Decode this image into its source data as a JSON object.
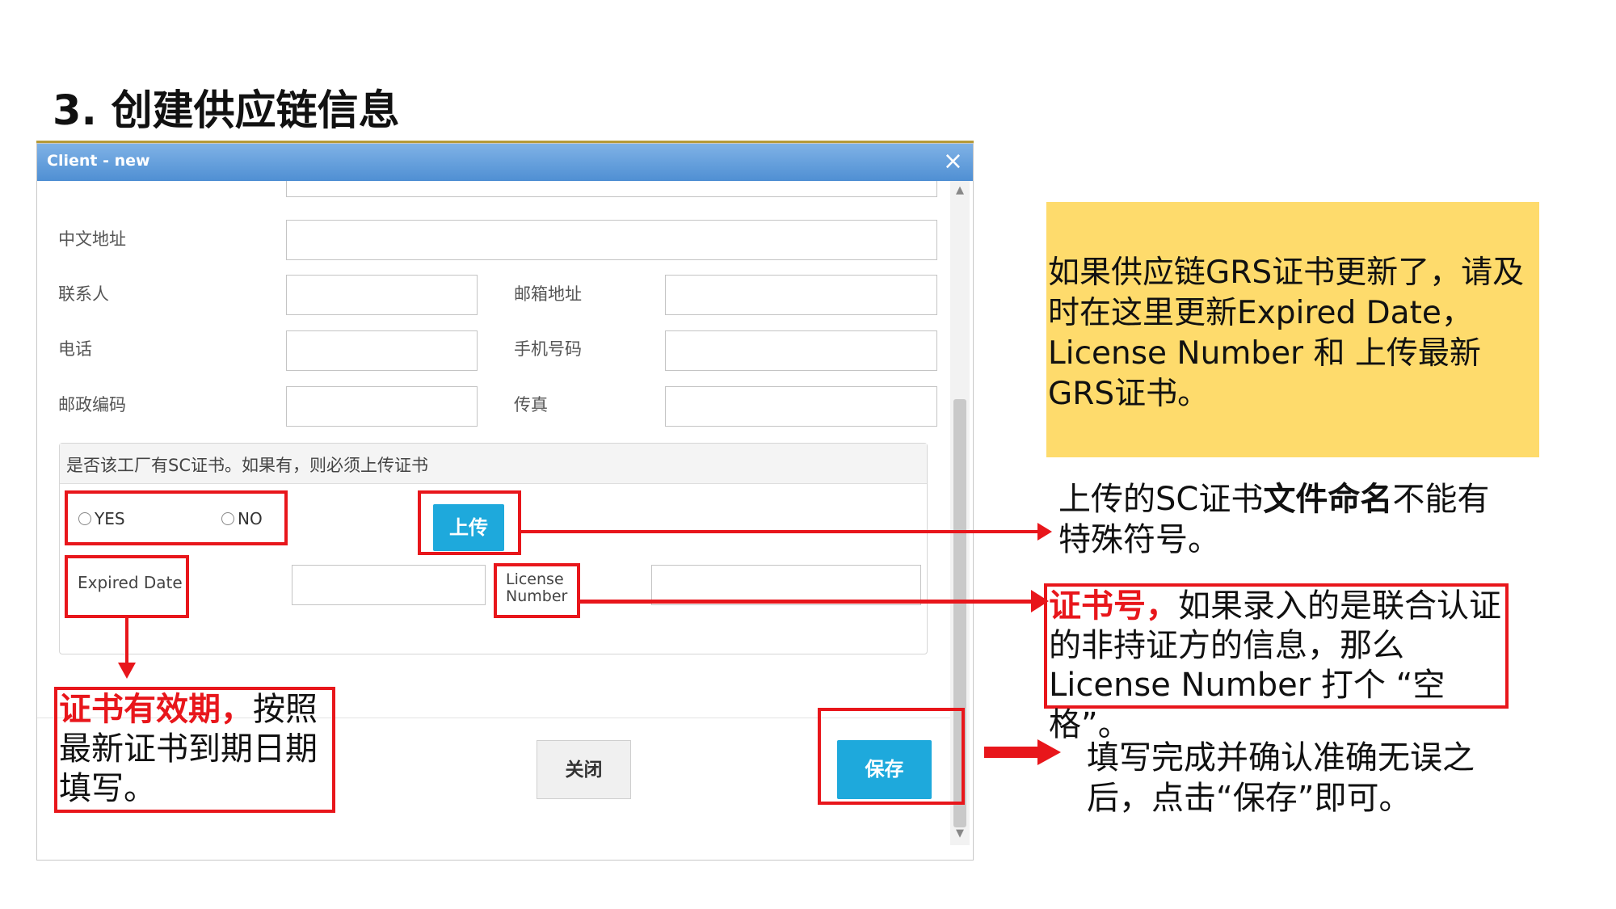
{
  "slide": {
    "title": "3. 创建供应链信息"
  },
  "dialog": {
    "title": "Client - new",
    "close_icon": "×",
    "scroll_up_icon": "▲",
    "scroll_down_icon": "▼",
    "fields": {
      "chinese_address_label": "中文地址",
      "contact_label": "联系人",
      "email_label": "邮箱地址",
      "phone_label": "电话",
      "mobile_label": "手机号码",
      "postcode_label": "邮政编码",
      "fax_label": "传真"
    },
    "sc_group": {
      "question": "是否该工厂有SC证书。如果有，则必须上传证书",
      "yes_label": "YES",
      "no_label": "NO",
      "upload_button": "上传",
      "expired_date_label": "Expired Date",
      "license_label_line1": "License",
      "license_label_line2": "Number"
    },
    "buttons": {
      "close": "关闭",
      "save": "保存"
    }
  },
  "annotations": {
    "yellow_note": "如果供应链GRS证书更新了，请及时在这里更新Expired Date，License Number 和 上传最新GRS证书。",
    "upload_note_pre": "上传的SC证书",
    "upload_note_bold": "文件命名",
    "upload_note_post": "不能有特殊符号。",
    "license_note_red": "证书号，",
    "license_note_rest": "如果录入的是联合认证的非持证方的信息，那么License Number 打个 “空格”。",
    "expiry_note_red": "证书有效期，",
    "expiry_note_rest": "按照最新证书到期日期填写。",
    "save_note": "填写完成并确认准确无误之后，点击“保存”即可。"
  },
  "colors": {
    "highlight_red": "#e8161b",
    "note_yellow": "#fedb6c",
    "save_blue": "#1ea9dc",
    "titlebar_blue": "#5b9bd9"
  }
}
